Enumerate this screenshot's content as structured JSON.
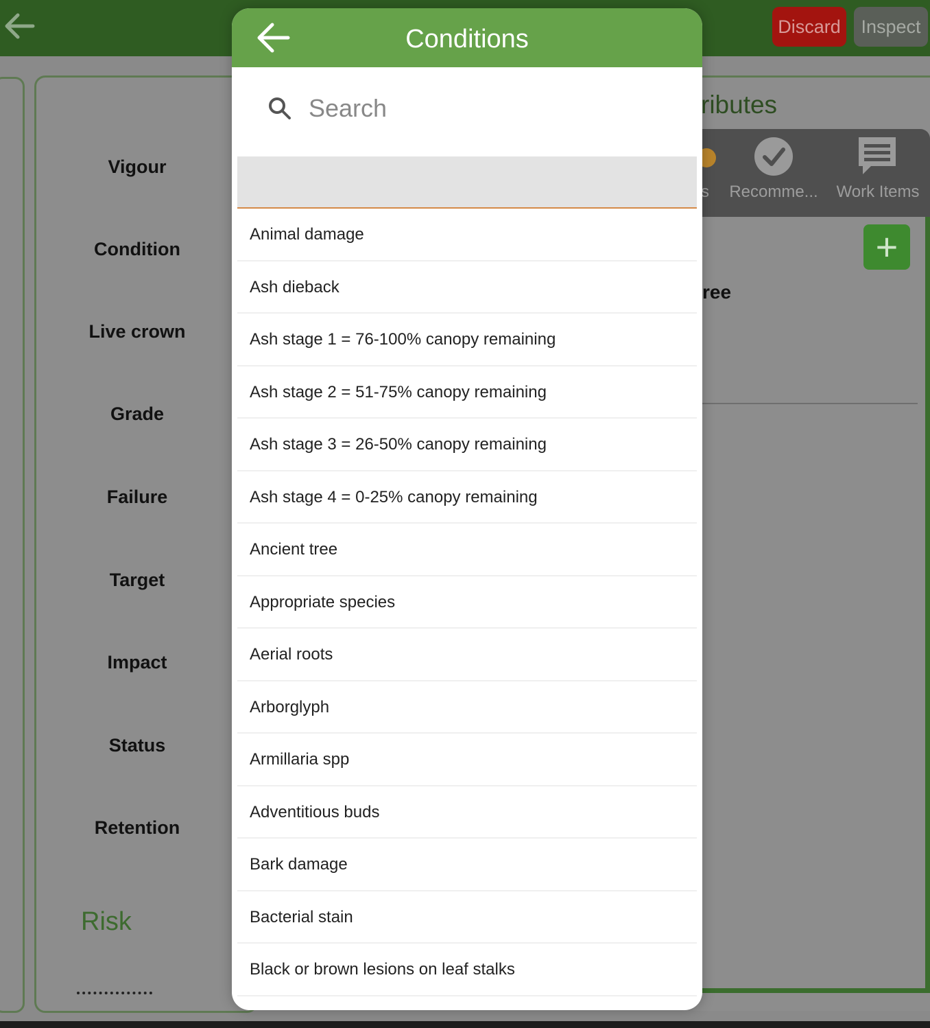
{
  "topbar": {
    "discard_label": "Discard",
    "inspect_label": "Inspect"
  },
  "left_panel": {
    "fields": [
      "Vigour",
      "Condition",
      "Live crown",
      "Grade",
      "Failure",
      "Target",
      "Impact",
      "Status",
      "Retention"
    ],
    "risk_label": "Risk"
  },
  "right_panel": {
    "title_fragment": "ributes",
    "tabs": [
      {
        "label": "s",
        "icon": "orange-dot-icon"
      },
      {
        "label": "Recomme...",
        "icon": "checkmark-circle-icon"
      },
      {
        "label": "Work Items",
        "icon": "message-icon"
      }
    ],
    "tree_text": "ree",
    "add_label": "+"
  },
  "modal": {
    "title": "Conditions",
    "search_placeholder": "Search",
    "items": [
      "Animal damage",
      "Ash dieback",
      "Ash stage 1 = 76-100% canopy remaining",
      "Ash stage 2 = 51-75% canopy remaining",
      "Ash stage 3 = 26-50% canopy remaining",
      "Ash stage 4 = 0-25% canopy remaining",
      "Ancient tree",
      "Appropriate species",
      "Aerial roots",
      "Arborglyph",
      "Armillaria spp",
      "Adventitious buds",
      "Bark damage",
      "Bacterial stain",
      "Black or brown lesions on leaf stalks"
    ]
  },
  "colors": {
    "header_green": "#66a24a",
    "topbar_green": "#2f5c22",
    "discard_red": "#a3140f",
    "inspect_gray": "#5a5f58"
  }
}
